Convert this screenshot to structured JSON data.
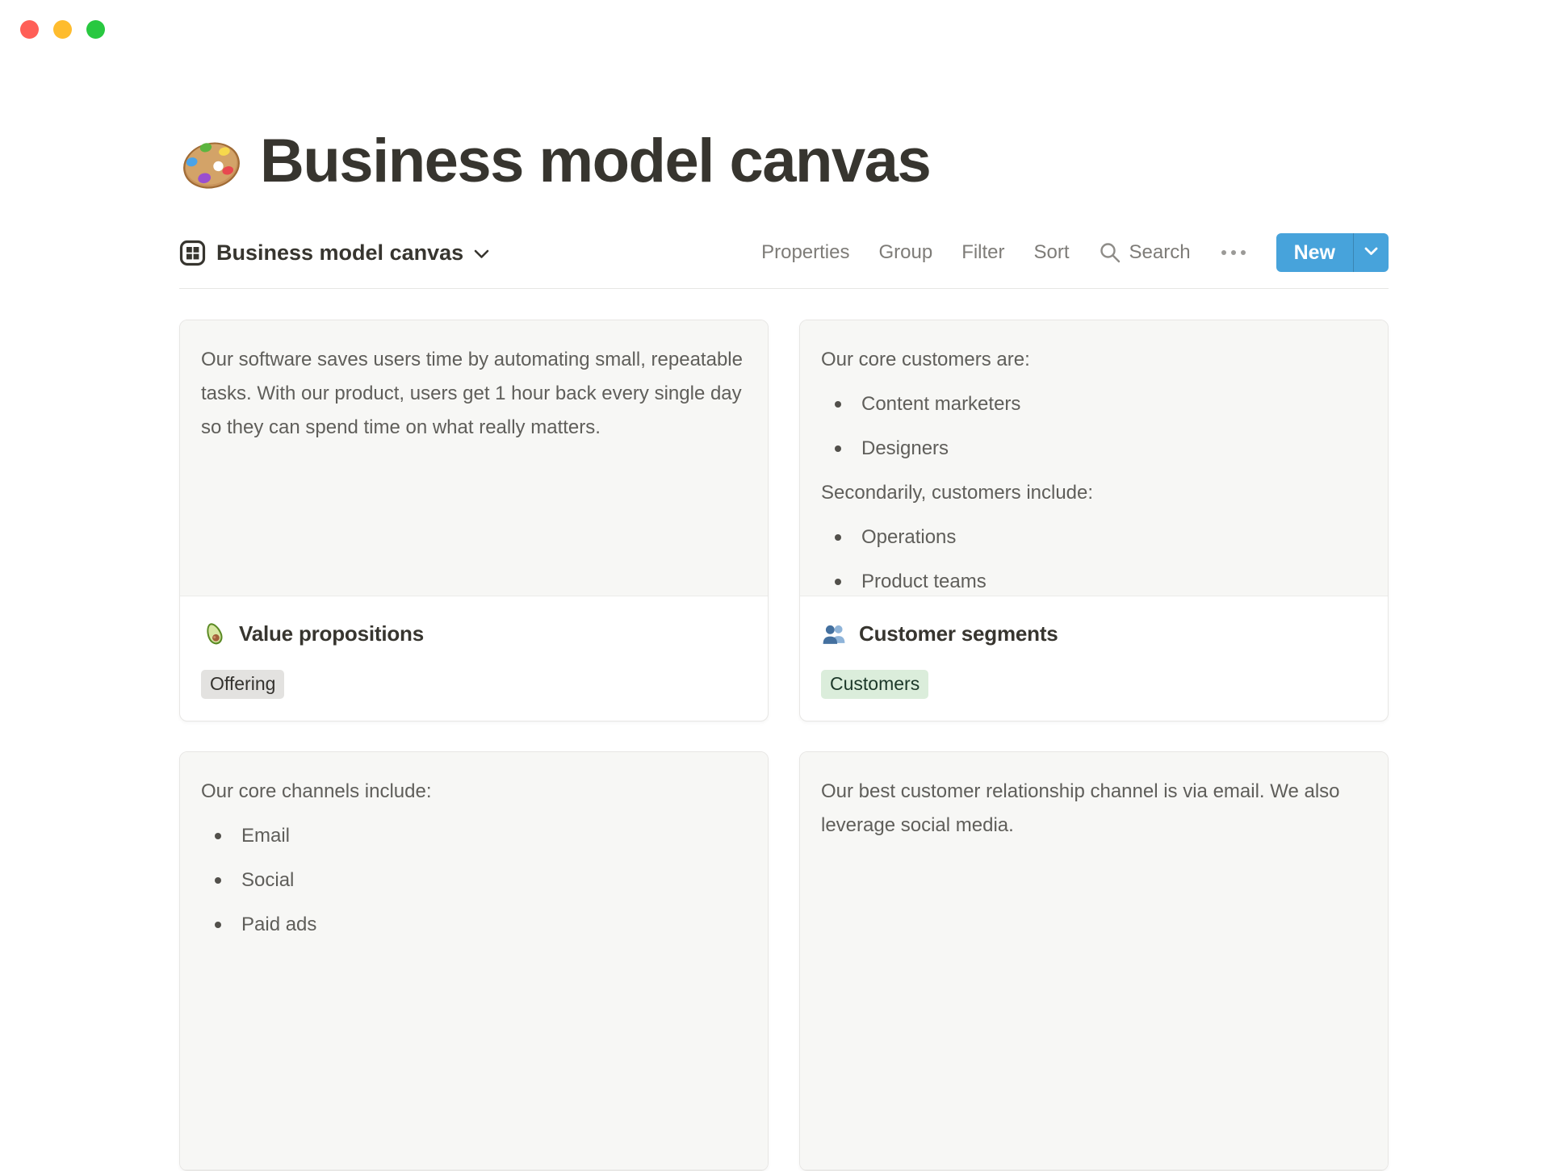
{
  "window": {
    "traffic_lights": [
      "close",
      "minimize",
      "zoom"
    ]
  },
  "page": {
    "emoji": "palette-emoji",
    "title": "Business model canvas"
  },
  "view_bar": {
    "view_icon": "gallery-view-icon",
    "view_name": "Business model canvas",
    "chevron_icon": "chevron-down-icon",
    "actions": {
      "properties_label": "Properties",
      "group_label": "Group",
      "filter_label": "Filter",
      "sort_label": "Sort",
      "search_icon": "search-icon",
      "search_label": "Search",
      "more_icon": "ellipsis-icon",
      "new_label": "New",
      "new_chevron_icon": "chevron-down-icon"
    }
  },
  "colors": {
    "accent_blue": "#47A3DB",
    "preview_background": "#F7F7F5",
    "card_border": "#E7E6E4",
    "tag_gray_bg": "#E3E2E0",
    "tag_green_bg": "#DBEDDB",
    "tag_green_text": "#1C3829",
    "traffic_red": "#FF5F57",
    "traffic_yellow": "#FEBC2E",
    "traffic_green": "#28C840"
  },
  "cards": [
    {
      "preview_blocks": [
        {
          "type": "p",
          "text": "Our software saves users time by automating small, repeatable tasks. With our product, users get 1 hour back every single day so they can spend time on what really matters."
        }
      ],
      "emoji": "avocado-emoji",
      "title": "Value propositions",
      "tag": {
        "label": "Offering",
        "color": "gray"
      }
    },
    {
      "preview_blocks": [
        {
          "type": "p",
          "text": "Our core customers are:"
        },
        {
          "type": "bullets",
          "items": [
            "Content marketers",
            "Designers"
          ]
        },
        {
          "type": "p",
          "text": "Secondarily, customers include:"
        },
        {
          "type": "bullets",
          "items": [
            "Operations",
            "Product teams"
          ]
        }
      ],
      "emoji": "people-emoji",
      "title": "Customer segments",
      "tag": {
        "label": "Customers",
        "color": "green"
      }
    },
    {
      "preview_blocks": [
        {
          "type": "p",
          "text": "Our core channels include:"
        },
        {
          "type": "bullets",
          "items": [
            "Email",
            "Social",
            "Paid ads"
          ]
        }
      ],
      "emoji": null,
      "title": null,
      "tag": null
    },
    {
      "preview_blocks": [
        {
          "type": "p",
          "text": "Our best customer relationship channel is via email. We also leverage social media."
        }
      ],
      "emoji": null,
      "title": null,
      "tag": null
    }
  ]
}
